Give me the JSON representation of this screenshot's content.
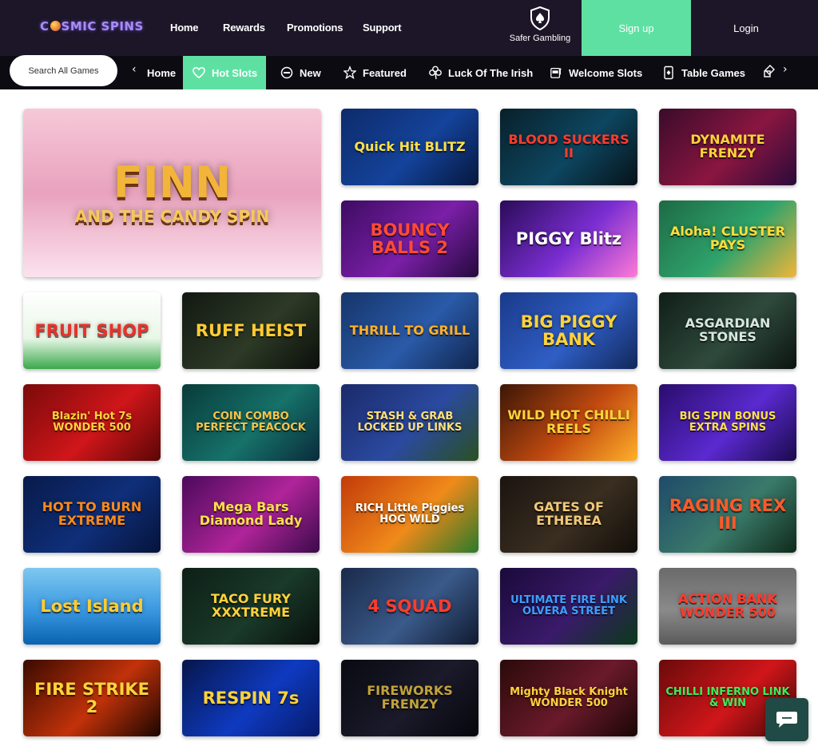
{
  "brand": {
    "logo_pre": "C",
    "logo_post": "SMIC SPINS"
  },
  "nav": [
    {
      "label": "Home"
    },
    {
      "label": "Rewards"
    },
    {
      "label": "Promotions"
    },
    {
      "label": "Support"
    }
  ],
  "safer_gambling": {
    "label": "Safer Gambling",
    "icon": "spade-shield-icon"
  },
  "auth": {
    "signup_label": "Sign up",
    "login_label": "Login"
  },
  "search": {
    "placeholder": "Search All Games"
  },
  "categories": [
    {
      "label": "Home",
      "icon": "chevron-left-icon"
    },
    {
      "label": "Hot Slots",
      "icon": "heart-icon",
      "active": true
    },
    {
      "label": "New",
      "icon": "new-icon"
    },
    {
      "label": "Featured",
      "icon": "star-icon"
    },
    {
      "label": "Luck Of The Irish",
      "icon": "clover-icon"
    },
    {
      "label": "Welcome Slots",
      "icon": "slot-machine-icon"
    },
    {
      "label": "Table Games",
      "icon": "cards-icon"
    }
  ],
  "colors": {
    "topbar": "#1c1628",
    "catbar": "#0d0b12",
    "accent": "#5fe0a3",
    "chat": "#1f4a46"
  },
  "games": [
    {
      "title": "FINN",
      "subtitle": "AND THE CANDY SPIN"
    },
    {
      "title": "Quick Hit BLITZ"
    },
    {
      "title": "BLOOD SUCKERS II"
    },
    {
      "title": "DYNAMITE FRENZY"
    },
    {
      "title": "BOUNCY BALLS 2"
    },
    {
      "title": "PIGGY Blitz"
    },
    {
      "title": "Aloha! CLUSTER PAYS"
    },
    {
      "title": "FRUIT SHOP"
    },
    {
      "title": "RUFF HEIST"
    },
    {
      "title": "THRILL TO GRILL"
    },
    {
      "title": "BIG PIGGY BANK"
    },
    {
      "title": "ASGARDIAN STONES"
    },
    {
      "title": "Blazin' Hot 7s WONDER 500"
    },
    {
      "title": "COIN COMBO PERFECT PEACOCK"
    },
    {
      "title": "STASH & GRAB LOCKED UP LINKS"
    },
    {
      "title": "WILD HOT CHILLI REELS"
    },
    {
      "title": "BIG SPIN BONUS EXTRA SPINS"
    },
    {
      "title": "HOT TO BURN EXTREME"
    },
    {
      "title": "Mega Bars Diamond Lady"
    },
    {
      "title": "RICH Little Piggies HOG WILD"
    },
    {
      "title": "GATES OF ETHEREA"
    },
    {
      "title": "RAGING REX III"
    },
    {
      "title": "Lost Island"
    },
    {
      "title": "TACO FURY XXXTREME"
    },
    {
      "title": "4 SQUAD"
    },
    {
      "title": "ULTIMATE FIRE LINK OLVERA STREET"
    },
    {
      "title": "ACTION BANK WONDER 500"
    },
    {
      "title": "FIRE STRIKE 2"
    },
    {
      "title": "RESPIN 7s"
    },
    {
      "title": "FIREWORKS FRENZY"
    },
    {
      "title": "Mighty Black Knight WONDER 500"
    },
    {
      "title": "CHILLI INFERNO LINK & WIN"
    }
  ]
}
